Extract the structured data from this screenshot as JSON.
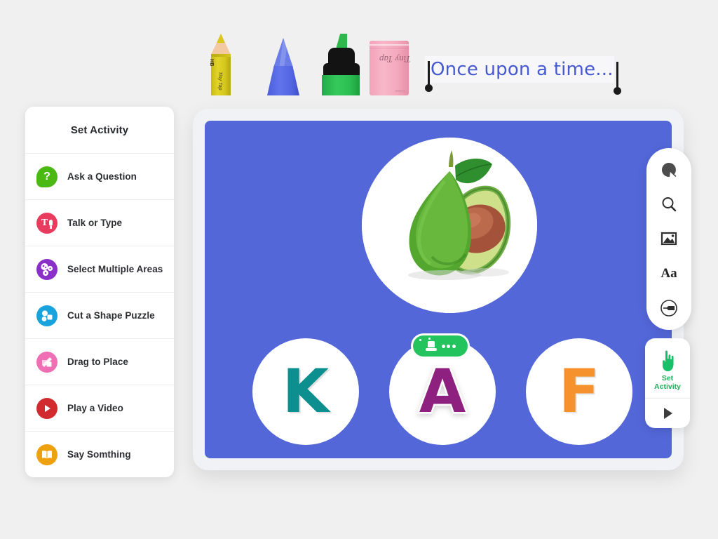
{
  "sidebar": {
    "title": "Set Activity",
    "items": [
      {
        "label": "Ask a Question",
        "icon": "question-bubble-icon",
        "color": "#4bb814"
      },
      {
        "label": "Talk or Type",
        "icon": "text-microphone-icon",
        "color": "#e83b5e"
      },
      {
        "label": "Select Multiple Areas",
        "icon": "multi-select-icon",
        "color": "#8b2fc9"
      },
      {
        "label": "Cut a Shape Puzzle",
        "icon": "shape-puzzle-icon",
        "color": "#19a3dd"
      },
      {
        "label": "Drag to Place",
        "icon": "drag-place-icon",
        "color": "#f06fb4"
      },
      {
        "label": "Play a Video",
        "icon": "play-video-icon",
        "color": "#d12a2f"
      },
      {
        "label": "Say Somthing",
        "icon": "open-book-icon",
        "color": "#efa010"
      }
    ]
  },
  "tools": {
    "pencil": {
      "name": "pencil-tool",
      "hardness": "HB",
      "brand": "Tiny Tap",
      "color": "#d4c51d"
    },
    "crayon": {
      "name": "crayon-tool",
      "color": "#5365e0"
    },
    "highlighter": {
      "name": "highlighter-tool",
      "color": "#2bbd51"
    },
    "eraser": {
      "name": "eraser-tool",
      "brand": "Tiny Tap",
      "sub": "Eraser",
      "color": "#f4a9be"
    }
  },
  "text_field": {
    "value": "Once upon a time...",
    "text_color": "#4759d0"
  },
  "canvas": {
    "background": "#5367d9",
    "media": {
      "name": "avocado-image",
      "alt": "Avocado"
    },
    "letters": [
      {
        "letter": "K",
        "color": "#0e8f8f",
        "has_badge": false
      },
      {
        "letter": "A",
        "color": "#8e2180",
        "has_badge": true,
        "badge_icon": "magic-hat-icon",
        "badge_color": "#23c45e"
      },
      {
        "letter": "F",
        "color": "#f5922d",
        "has_badge": false
      }
    ]
  },
  "toolbar": {
    "buttons": [
      {
        "icon": "paint-blob-icon"
      },
      {
        "icon": "magnifier-icon"
      },
      {
        "icon": "image-icon"
      },
      {
        "icon": "text-format-icon",
        "label": "Aa"
      },
      {
        "icon": "pen-circle-icon"
      }
    ]
  },
  "activity_panel": {
    "set_activity_label_line1": "Set",
    "set_activity_label_line2": "Activity",
    "set_activity_color": "#16b35a",
    "hand_icon": "pointing-hand-icon",
    "play_icon": "play-triangle-icon"
  }
}
